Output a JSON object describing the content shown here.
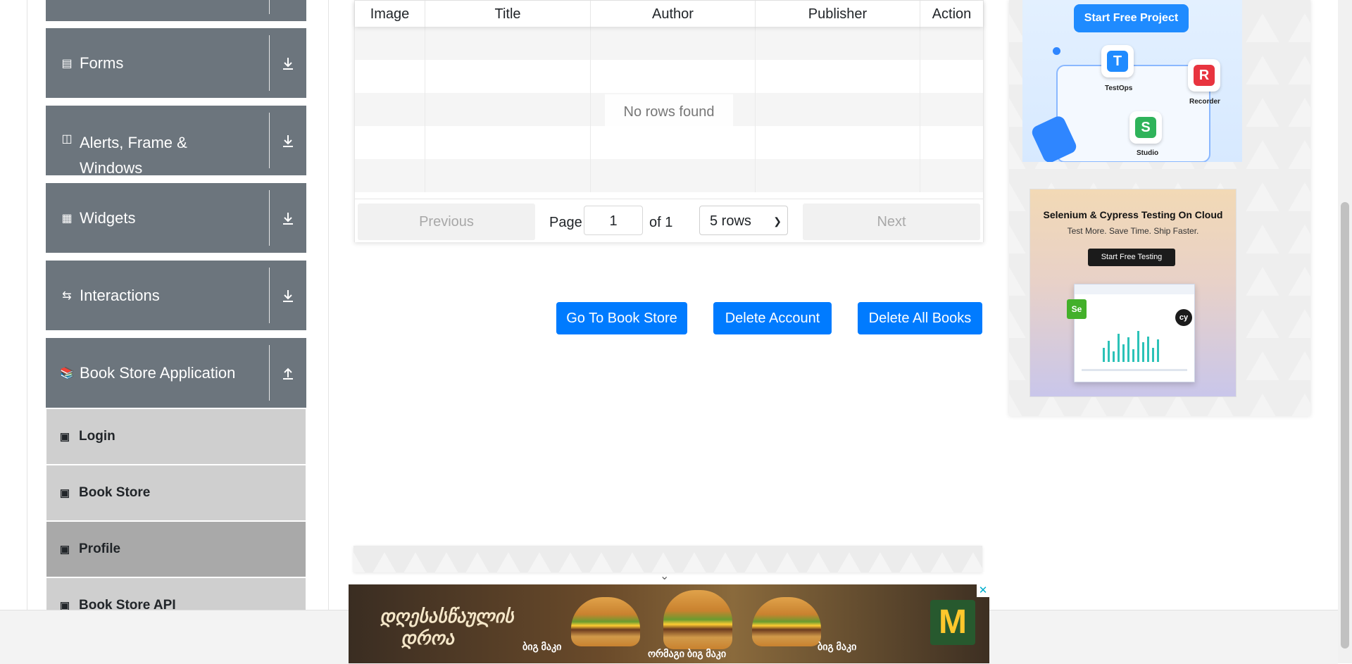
{
  "sidebar": {
    "groups": [
      {
        "label": "",
        "icon": "menu-group-icon",
        "expanded": false
      },
      {
        "label": "Forms",
        "icon": "forms-icon",
        "expanded": false
      },
      {
        "label": "Alerts, Frame & Windows",
        "label_line1": "Alerts, Frame &",
        "label_line2": "Windows",
        "icon": "window-icon",
        "expanded": false
      },
      {
        "label": "Widgets",
        "icon": "widgets-icon",
        "expanded": false
      },
      {
        "label": "Interactions",
        "icon": "interactions-icon",
        "expanded": false
      },
      {
        "label": "Book Store Application",
        "icon": "books-icon",
        "expanded": true
      }
    ],
    "items": [
      {
        "label": "Login",
        "icon": "html5-icon",
        "active": false
      },
      {
        "label": "Book Store",
        "icon": "html5-icon",
        "active": false
      },
      {
        "label": "Profile",
        "icon": "html5-icon",
        "active": true
      },
      {
        "label": "Book Store API",
        "icon": "html5-icon",
        "active": false
      }
    ]
  },
  "table": {
    "columns": [
      "Image",
      "Title",
      "Author",
      "Publisher",
      "Action"
    ],
    "empty_message": "No rows found",
    "pagination": {
      "previous_label": "Previous",
      "next_label": "Next",
      "page_label": "Page",
      "current_page": "1",
      "of_label": "of 1",
      "rows_selected": "5 rows"
    }
  },
  "actions": {
    "go_to_store": "Go To Book Store",
    "delete_account": "Delete Account",
    "delete_all_books": "Delete All Books"
  },
  "ads": {
    "katalon": {
      "cta": "Start Free Project",
      "tiles": [
        "TestOps",
        "Recorder",
        "Studio"
      ]
    },
    "lambdatest": {
      "headline": "Selenium & Cypress Testing On Cloud",
      "subhead": "Test More. Save Time. Ship Faster.",
      "cta": "Start Free Testing"
    },
    "bottom_banner": {
      "script_line1": "დღესასწაულის",
      "script_line2": "დროა",
      "burger_labels": [
        "ბიგ მაკი",
        "ორმაგი ბიგ მაკი",
        "ბიგ მაკი"
      ],
      "logo": "M",
      "close_icon": "close-icon"
    }
  },
  "colors": {
    "sidebar_group_bg": "#6c757d",
    "sidebar_item_bg": "#cfcfcf",
    "sidebar_item_active_bg": "#a9a9a9",
    "primary_button": "#007bff"
  }
}
